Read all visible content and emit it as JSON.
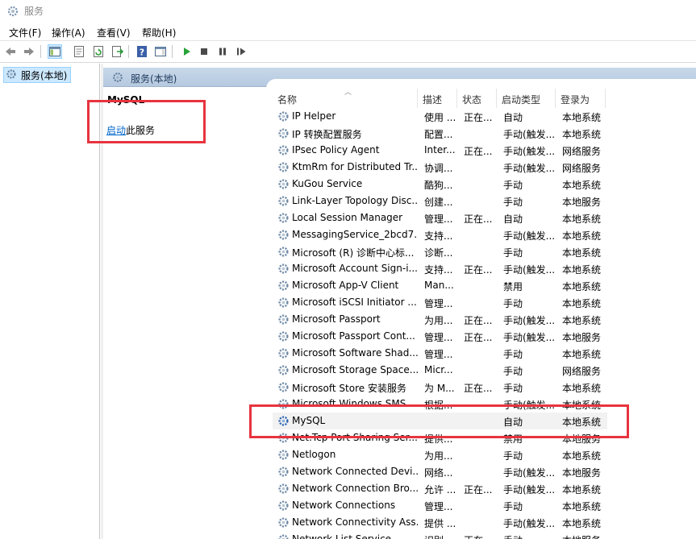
{
  "window": {
    "title": "服务"
  },
  "menu": [
    "文件(F)",
    "操作(A)",
    "查看(V)",
    "帮助(H)"
  ],
  "toolbar": {
    "icons": [
      "back-icon",
      "forward-icon",
      "show-hide-tree-icon",
      "properties-icon",
      "refresh-icon",
      "export-list-icon",
      "help-icon",
      "action-pane-icon",
      "start-service-icon",
      "stop-service-icon",
      "pause-service-icon",
      "resume-service-icon"
    ]
  },
  "tree": {
    "item_label": "服务(本地)"
  },
  "pane": {
    "header_title": "服务(本地)"
  },
  "details": {
    "service_name": "MySQL",
    "start_link": "启动",
    "start_suffix": "此服务"
  },
  "columns": {
    "name": "名称",
    "desc": "描述",
    "status": "状态",
    "startup": "启动类型",
    "logon": "登录为"
  },
  "services": [
    {
      "name": "IP Helper",
      "desc": "使用 ...",
      "status": "正在...",
      "startup": "自动",
      "logon": "本地系统"
    },
    {
      "name": "IP 转换配置服务",
      "desc": "配置...",
      "status": "",
      "startup": "手动(触发...",
      "logon": "本地系统"
    },
    {
      "name": "IPsec Policy Agent",
      "desc": "Inter...",
      "status": "正在...",
      "startup": "手动(触发...",
      "logon": "网络服务"
    },
    {
      "name": "KtmRm for Distributed Tr...",
      "desc": "协调...",
      "status": "",
      "startup": "手动(触发...",
      "logon": "网络服务"
    },
    {
      "name": "KuGou Service",
      "desc": "酷狗...",
      "status": "",
      "startup": "手动",
      "logon": "本地系统"
    },
    {
      "name": "Link-Layer Topology Disc...",
      "desc": "创建...",
      "status": "",
      "startup": "手动",
      "logon": "本地服务"
    },
    {
      "name": "Local Session Manager",
      "desc": "管理...",
      "status": "正在...",
      "startup": "自动",
      "logon": "本地系统"
    },
    {
      "name": "MessagingService_2bcd7...",
      "desc": "支持...",
      "status": "",
      "startup": "手动(触发...",
      "logon": "本地系统"
    },
    {
      "name": "Microsoft (R) 诊断中心标...",
      "desc": "诊断...",
      "status": "",
      "startup": "手动",
      "logon": "本地系统"
    },
    {
      "name": "Microsoft Account Sign-i...",
      "desc": "支持...",
      "status": "正在...",
      "startup": "手动(触发...",
      "logon": "本地系统"
    },
    {
      "name": "Microsoft App-V Client",
      "desc": "Man...",
      "status": "",
      "startup": "禁用",
      "logon": "本地系统"
    },
    {
      "name": "Microsoft iSCSI Initiator ...",
      "desc": "管理...",
      "status": "",
      "startup": "手动",
      "logon": "本地系统"
    },
    {
      "name": "Microsoft Passport",
      "desc": "为用...",
      "status": "正在...",
      "startup": "手动(触发...",
      "logon": "本地系统"
    },
    {
      "name": "Microsoft Passport Cont...",
      "desc": "管理...",
      "status": "正在...",
      "startup": "手动(触发...",
      "logon": "本地服务"
    },
    {
      "name": "Microsoft Software Shad...",
      "desc": "管理...",
      "status": "",
      "startup": "手动",
      "logon": "本地系统"
    },
    {
      "name": "Microsoft Storage Space...",
      "desc": "Micr...",
      "status": "",
      "startup": "手动",
      "logon": "网络服务"
    },
    {
      "name": "Microsoft Store 安装服务",
      "desc": "为 M...",
      "status": "正在...",
      "startup": "手动",
      "logon": "本地系统"
    },
    {
      "name": "Microsoft Windows SMS ...",
      "desc": "根据...",
      "status": "",
      "startup": "手动(触发...",
      "logon": "本地系统"
    },
    {
      "name": "MySQL",
      "desc": "",
      "status": "",
      "startup": "自动",
      "logon": "本地系统",
      "selected": true
    },
    {
      "name": "Net.Tcp Port Sharing Ser...",
      "desc": "提供...",
      "status": "",
      "startup": "禁用",
      "logon": "本地服务"
    },
    {
      "name": "Netlogon",
      "desc": "为用...",
      "status": "",
      "startup": "手动",
      "logon": "本地系统"
    },
    {
      "name": "Network Connected Devi...",
      "desc": "网络...",
      "status": "",
      "startup": "手动(触发...",
      "logon": "本地服务"
    },
    {
      "name": "Network Connection Bro...",
      "desc": "允许 ...",
      "status": "正在...",
      "startup": "手动(触发...",
      "logon": "本地系统"
    },
    {
      "name": "Network Connections",
      "desc": "管理...",
      "status": "",
      "startup": "手动",
      "logon": "本地系统"
    },
    {
      "name": "Network Connectivity Ass...",
      "desc": "提供 ...",
      "status": "",
      "startup": "手动(触发...",
      "logon": "本地系统"
    },
    {
      "name": "Network List Service",
      "desc": "识别...",
      "status": "正在...",
      "startup": "手动",
      "logon": "本地服务"
    }
  ],
  "colors": {
    "highlight_box": "#e7343f",
    "pane_header": "#c8d8ea",
    "link": "#0066cc",
    "selection": "#cce8ff"
  }
}
